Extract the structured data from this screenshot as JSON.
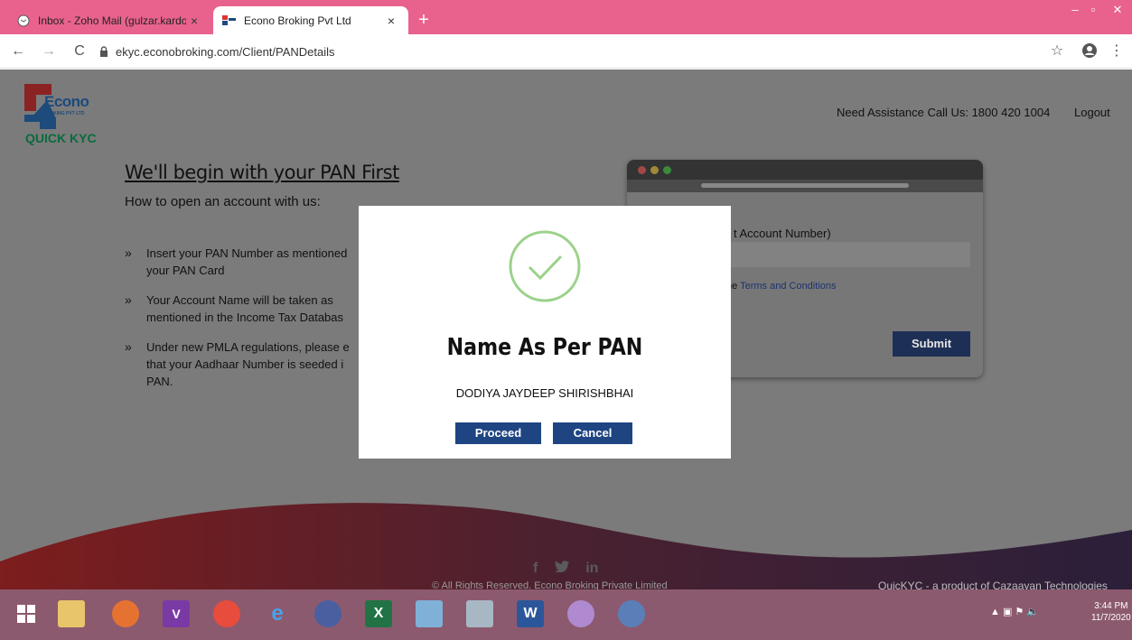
{
  "browser": {
    "tabs": [
      {
        "title": "Inbox - Zoho Mail (gulzar.kardor",
        "active": false
      },
      {
        "title": "Econo Broking Pvt Ltd",
        "active": true
      }
    ],
    "url": "ekyc.econobroking.com/Client/PANDetails"
  },
  "header": {
    "logo_text": "Econo",
    "logo_sub": "BROKING PVT LTD",
    "quick_kyc": "QUICK KYC",
    "assistance": "Need Assistance Call Us: 1800 420 1004",
    "logout": "Logout"
  },
  "main": {
    "heading": "We'll begin with your PAN First",
    "subheading": "How to open an account with us:",
    "steps": [
      "Insert your PAN Number as mentioned your PAN Card",
      "Your Account Name will be taken as mentioned in the Income Tax Databas",
      "Under new PMLA regulations, please e that your Aadhaar Number is seeded i PAN."
    ]
  },
  "form_mock": {
    "label_fragment": "t Account Number)",
    "terms_prefix": "he ",
    "terms_link": "Terms and Conditions",
    "submit": "Submit"
  },
  "footer": {
    "social": [
      "f",
      "🐦",
      "in"
    ],
    "copyright": "© All Rights Reserved. Econo Broking Private Limited",
    "product": "QuicKYC - a product of Cazaayan Technologies"
  },
  "modal": {
    "title": "Name As Per PAN",
    "name": "DODIYA JAYDEEP SHIRISHBHAI",
    "proceed": "Proceed",
    "cancel": "Cancel"
  },
  "taskbar": {
    "time": "3:44 PM",
    "date": "11/7/2020"
  },
  "colors": {
    "tab_bar": "#e9628e",
    "button_blue": "#1e4582",
    "check_green": "#9bd28a"
  }
}
